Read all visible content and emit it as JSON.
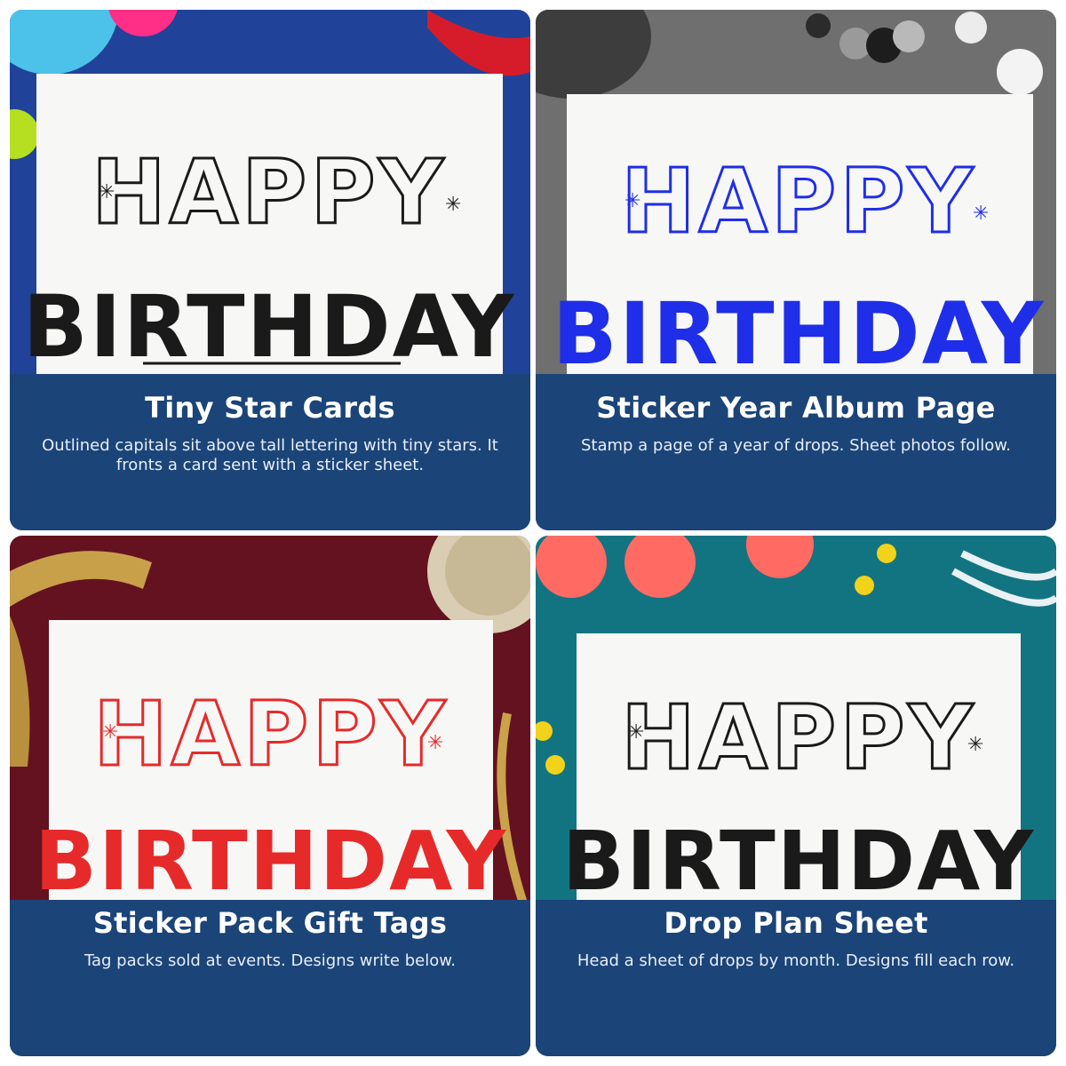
{
  "panels": [
    {
      "title": "Tiny Star Cards",
      "description": "Outlined capitals sit above tall lettering with tiny stars. It fronts a card sent with a sticker sheet.",
      "artwork_top": "HAPPY",
      "artwork_bottom": "BIRTHDAY",
      "ink_color": "#1a1a1a",
      "background": "blue fabric with colored paper circles and red ribbon"
    },
    {
      "title": "Sticker Year Album Page",
      "description": "Stamp a page of a year of drops. Sheet photos follow.",
      "artwork_top": "HAPPY",
      "artwork_bottom": "BIRTHDAY",
      "ink_color": "#1f2ee8",
      "background": "gray felt with yarn, hexagon beads and white buttons"
    },
    {
      "title": "Sticker Pack Gift Tags",
      "description": "Tag packs sold at events. Designs write below.",
      "artwork_top": "HAPPY",
      "artwork_bottom": "BIRTHDAY",
      "ink_color": "#e62a2a",
      "background": "burgundy fabric with gold ribbon, twine and scissors"
    },
    {
      "title": "Drop Plan Sheet",
      "description": "Head a sheet of drops by month. Designs fill each row.",
      "artwork_top": "HAPPY",
      "artwork_bottom": "BIRTHDAY",
      "ink_color": "#1a1a1a",
      "background": "teal felt with coral pompoms, yellow beads and white yarn"
    }
  ],
  "colors": {
    "banner": "#1b4478",
    "banner_text": "#ffffff"
  }
}
